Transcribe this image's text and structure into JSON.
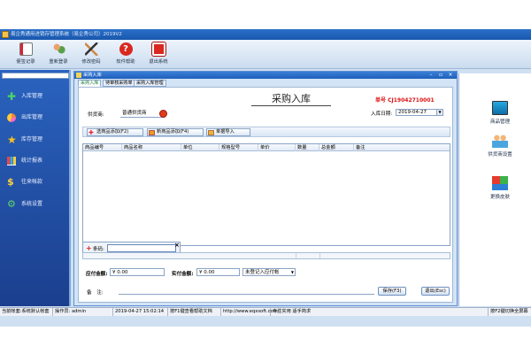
{
  "window": {
    "title": "易企秀通用进销存管理系统（易企秀公司）2019V2"
  },
  "toolbar": {
    "items": [
      {
        "label": "便签记录",
        "icon": "notepad-icon"
      },
      {
        "label": "重新登录",
        "icon": "users-icon"
      },
      {
        "label": "修改密码",
        "icon": "keys-icon"
      },
      {
        "label": "软件帮助",
        "icon": "help-icon"
      },
      {
        "label": "退出系统",
        "icon": "exit-icon"
      }
    ]
  },
  "sidebar": {
    "items": [
      {
        "label": "入库管理",
        "icon": "plus-icon"
      },
      {
        "label": "出库管理",
        "icon": "pie-chart-icon"
      },
      {
        "label": "库存管理",
        "icon": "star-icon"
      },
      {
        "label": "统计报表",
        "icon": "bar-chart-icon"
      },
      {
        "label": "往来帐款",
        "icon": "dollar-icon"
      },
      {
        "label": "系统设置",
        "icon": "gear-icon"
      }
    ]
  },
  "rightpanel": {
    "items": [
      {
        "label": "商品管理",
        "icon": "computer-icon"
      },
      {
        "label": "供货商设置",
        "icon": "people-icon"
      },
      {
        "label": "更换皮肤",
        "icon": "cubes-icon"
      }
    ]
  },
  "document": {
    "caption": "采购入库",
    "tabs": [
      "采购入库",
      "待审核采购单",
      "采购入库管理"
    ],
    "active_tab": 0
  },
  "form": {
    "title": "采购入库",
    "order_no_label": "单号",
    "order_no": "CJ19042710001",
    "supplier_label": "供货商:",
    "supplier_value": "普通供货商",
    "date_label": "入库日期:",
    "date_value": "2019-04-27",
    "buttons": [
      "选商品添加(F2)",
      "新商品添加(F4)",
      "单据导入"
    ],
    "columns": [
      "商品编号",
      "商品名称",
      "单位",
      "规格型号",
      "单价",
      "数量",
      "总金额",
      "备注"
    ],
    "barcode_label": "条码:",
    "payable_label": "应付金额:",
    "payable_value": "¥ 0.00",
    "paid_label": "实付金额:",
    "paid_value": "¥ 0.00",
    "payment_select": "未登记入应付帐",
    "note_label": "备　注:",
    "save_label": "保存(F3)",
    "exit_label": "退出(Esc)"
  },
  "statusbar": {
    "account": "当前帐套:系统默认帐套",
    "operator": "操作员: admin",
    "datetime": "2019-04-27 15:02:14",
    "help_link": "按F1键查看帮助文档",
    "website": "http://www.eqxsoft.com/",
    "slogan": "专注实用 适手简求",
    "hotkey_hint": "按F2键切换全屏幕"
  },
  "colors": {
    "title_bar": "#1a57ad",
    "sidebar": "#1b3f8e",
    "order_no": "#dd1111",
    "active_tab_text": "#1a7d3c"
  }
}
